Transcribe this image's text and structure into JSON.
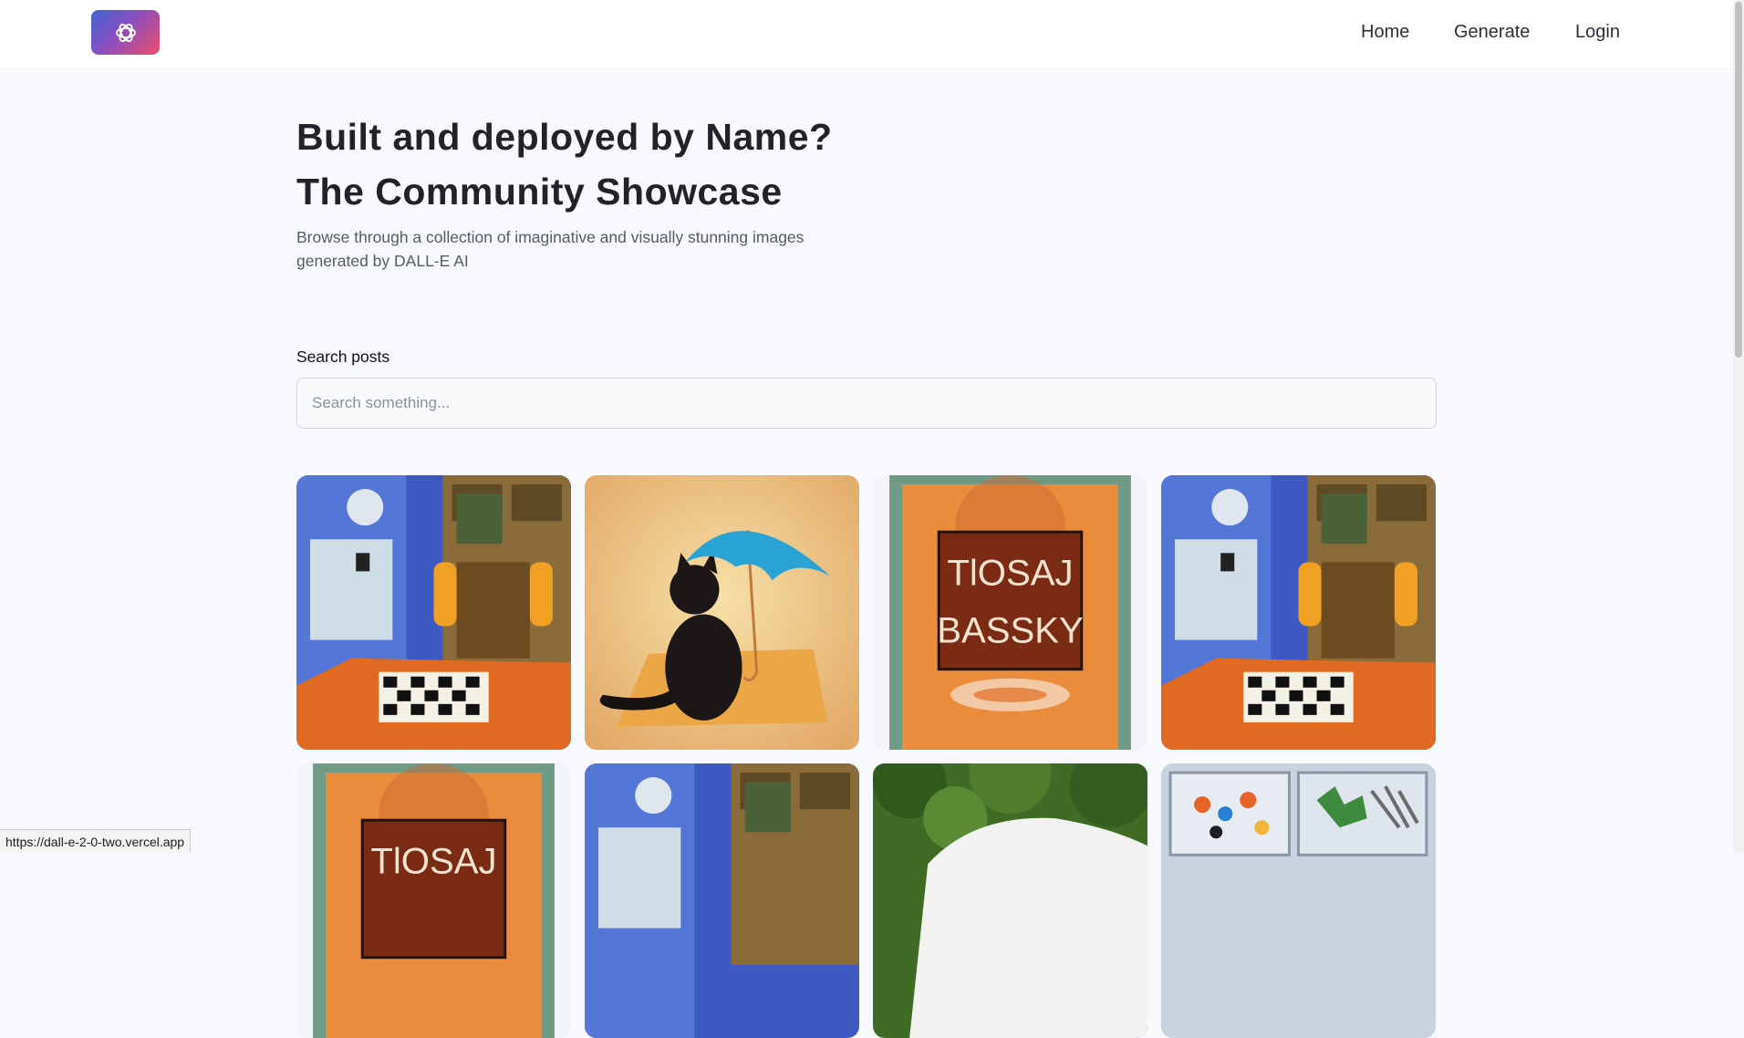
{
  "header": {
    "logo_icon": "openai-logo-icon",
    "nav": {
      "home": "Home",
      "generate": "Generate",
      "login": "Login"
    }
  },
  "hero": {
    "title_line1": "Built and deployed by Name?",
    "title_line2": "The Community Showcase",
    "subtitle_line1": "Browse through a collection of imaginative and visually stunning images",
    "subtitle_line2": "generated by DALL-E AI"
  },
  "search": {
    "label": "Search posts",
    "placeholder": "Search something...",
    "value": ""
  },
  "gallery": {
    "posts": [
      {
        "image": "robots-playing-chess"
      },
      {
        "image": "black-cat-with-umbrella"
      },
      {
        "image": "orange-poster-text"
      },
      {
        "image": "robots-playing-chess"
      },
      {
        "image": "orange-poster-text"
      },
      {
        "image": "robots-playing-chess"
      },
      {
        "image": "white-object-on-grass"
      },
      {
        "image": "jewelry-organizer-box"
      }
    ],
    "poster_text_line1": "TlOSAJ",
    "poster_text_line2": "BASSKY"
  },
  "status_bar": {
    "url": "https://dall-e-2-0-two.vercel.app"
  },
  "colors": {
    "background": "#f8f9fc",
    "logo_gradient_start": "#3f63d3",
    "logo_gradient_end": "#ef4f6a",
    "title": "#222328"
  }
}
